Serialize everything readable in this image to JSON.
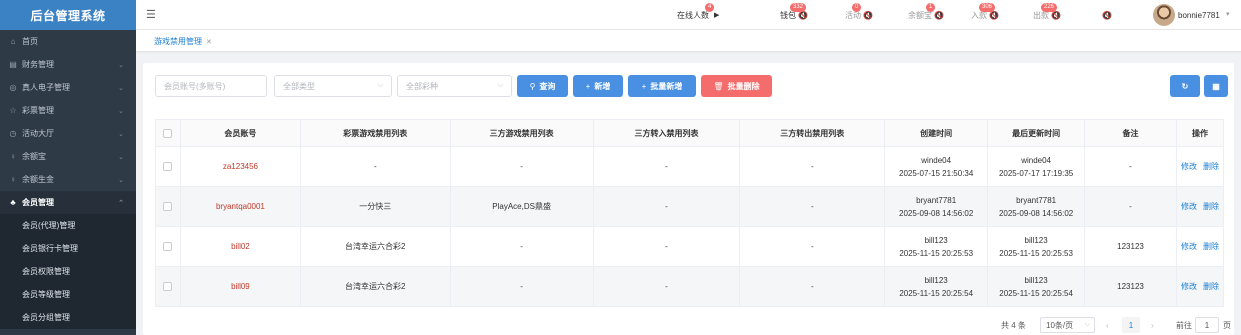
{
  "app": {
    "title": "后台管理系统"
  },
  "sidebar": {
    "items": [
      {
        "icon": "home-icon",
        "glyph": "⌂",
        "label": "首页",
        "arrow": false
      },
      {
        "icon": "finance-icon",
        "glyph": "▤",
        "label": "财务管理",
        "arrow": true
      },
      {
        "icon": "live-casino-icon",
        "glyph": "◎",
        "label": "真人电子管理",
        "arrow": true
      },
      {
        "icon": "lottery-icon",
        "glyph": "☆",
        "label": "彩票管理",
        "arrow": true
      },
      {
        "icon": "activity-icon",
        "glyph": "◷",
        "label": "活动大厅",
        "arrow": true
      },
      {
        "icon": "balance-treasure-icon",
        "glyph": "♀",
        "label": "余额宝",
        "arrow": true
      },
      {
        "icon": "balance-interest-icon",
        "glyph": "♀",
        "label": "余额生金",
        "arrow": true
      },
      {
        "icon": "member-icon",
        "glyph": "♣",
        "label": "会员管理",
        "arrow": true,
        "open": true
      }
    ],
    "subitems": [
      "会员(代理)管理",
      "会员银行卡管理",
      "会员权限管理",
      "会员等级管理",
      "会员分组管理"
    ]
  },
  "header": {
    "online": {
      "label": "在线人数",
      "count": "4"
    },
    "wallet": {
      "label": "钱包",
      "count": "332"
    },
    "activity": {
      "label": "活动",
      "count": "0"
    },
    "yuebao": {
      "label": "余额宝",
      "count": "1"
    },
    "deposit": {
      "label": "入款",
      "count": "306"
    },
    "withdraw": {
      "label": "出款",
      "count": "226"
    },
    "username": "bonnie7781"
  },
  "tabs": [
    {
      "label": "游戏禁用管理"
    }
  ],
  "filters": {
    "account_placeholder": "会员账号(多账号)",
    "type_placeholder": "全部类型",
    "lottery_placeholder": "全部彩种"
  },
  "buttons": {
    "query": "查询",
    "add": "新增",
    "batch_add": "批量新增",
    "batch_delete": "批量删除"
  },
  "table": {
    "headers": [
      "会员账号",
      "彩票游戏禁用列表",
      "三方游戏禁用列表",
      "三方转入禁用列表",
      "三方转出禁用列表",
      "创建时间",
      "最后更新时间",
      "备注",
      "操作"
    ],
    "rows": [
      {
        "account": "za123456",
        "lottery": "-",
        "third_game": "-",
        "third_in": "-",
        "third_out": "-",
        "created_by": "winde04",
        "created_at": "2025-07-15 21:50:34",
        "updated_by": "winde04",
        "updated_at": "2025-07-17 17:19:35",
        "remark": "-",
        "edit": "修改",
        "delete": "删除"
      },
      {
        "account": "bryantqa0001",
        "lottery": "一分快三",
        "third_game": "PlayAce,DS鼎盛",
        "third_in": "-",
        "third_out": "-",
        "created_by": "bryant7781",
        "created_at": "2025-09-08 14:56:02",
        "updated_by": "bryant7781",
        "updated_at": "2025-09-08 14:56:02",
        "remark": "-",
        "edit": "修改",
        "delete": "删除"
      },
      {
        "account": "bill02",
        "lottery": "台湾幸运六合彩2",
        "third_game": "-",
        "third_in": "-",
        "third_out": "-",
        "created_by": "bill123",
        "created_at": "2025-11-15 20:25:53",
        "updated_by": "bill123",
        "updated_at": "2025-11-15 20:25:53",
        "remark": "123123",
        "edit": "修改",
        "delete": "删除"
      },
      {
        "account": "bill09",
        "lottery": "台湾幸运六合彩2",
        "third_game": "-",
        "third_in": "-",
        "third_out": "-",
        "created_by": "bill123",
        "created_at": "2025-11-15 20:25:54",
        "updated_by": "bill123",
        "updated_at": "2025-11-15 20:25:54",
        "remark": "123123",
        "edit": "修改",
        "delete": "删除"
      }
    ]
  },
  "pagination": {
    "total": "共 4 条",
    "page_size": "10条/页",
    "current_page": "1",
    "goto_label": "前往",
    "goto_value": "1",
    "page_suffix": "页"
  },
  "colors": {
    "accent": "#4a90e2",
    "danger": "#f56c6c",
    "sidebar_bg": "#2f3a47",
    "logo_bg": "#3b82c4"
  }
}
